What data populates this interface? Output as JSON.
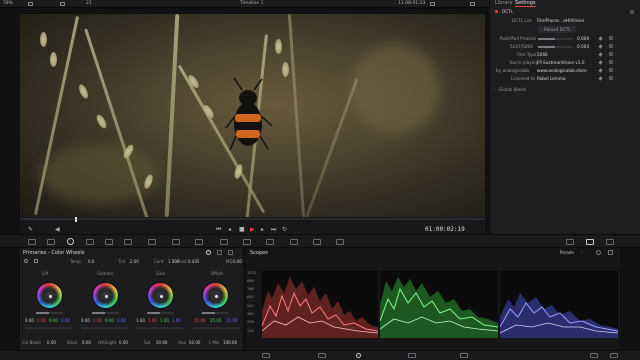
{
  "topbar": {
    "zoom": "78%",
    "timeline_title": "Timeline 1",
    "timecode": "11:08:01:23",
    "counter": "21"
  },
  "viewer": {
    "timecode": "01:00:02:19"
  },
  "right_panel": {
    "tabs": [
      "Library",
      "Settings"
    ],
    "section": "DCTL",
    "dctl_list_label": "DCTL List",
    "dctl_list_value": "FilmProces...aHtlVision",
    "reload_button": "Reload DCTL",
    "params": [
      {
        "label": "Push/Pull Process",
        "value": "0.009"
      },
      {
        "label": "5247/5293",
        "value": "0.504"
      },
      {
        "label": "Film Type",
        "value": "5066"
      },
      {
        "label": "You're playing",
        "value": "FP EastmanVision v1.0"
      },
      {
        "label": "by analogicalab",
        "value": "www.analogicalab.store"
      },
      {
        "label": "Licensed to",
        "value": "Robel Lemma"
      }
    ],
    "global_blend": "Global Blend"
  },
  "primaries": {
    "title": "Primaries - Color Wheels",
    "top_params": [
      {
        "label": "Temp",
        "value": "0.0"
      },
      {
        "label": "Tint",
        "value": "2.00"
      },
      {
        "label": "Cont",
        "value": "1.000"
      },
      {
        "label": "Pivot",
        "value": "0.435"
      },
      {
        "label": "MD",
        "value": "0.00"
      }
    ],
    "wheels": [
      {
        "name": "Lift",
        "values": [
          "0.00",
          "0.00",
          "0.00",
          "0.00"
        ]
      },
      {
        "name": "Gamma",
        "values": [
          "0.00",
          "0.00",
          "0.00",
          "0.00"
        ]
      },
      {
        "name": "Gain",
        "values": [
          "1.00",
          "1.00",
          "1.00",
          "1.00"
        ]
      },
      {
        "name": "Offset",
        "values": [
          "25.00",
          "25.00",
          "25.00",
          ""
        ]
      }
    ],
    "bottom_params": [
      {
        "label": "Col Boost",
        "value": "0.00"
      },
      {
        "label": "Shad",
        "value": "0.00"
      },
      {
        "label": "Hilt/Light",
        "value": "0.00"
      },
      {
        "label": "Sat",
        "value": "50.00"
      },
      {
        "label": "Hue",
        "value": "50.00"
      },
      {
        "label": "L Mix",
        "value": "100.00"
      }
    ],
    "footer": "DaVinci Resolve Studio 18.6"
  },
  "scopes": {
    "title": "Scopes",
    "mode": "Parade",
    "y_labels": [
      "1023",
      "896",
      "768",
      "640",
      "512",
      "384",
      "256",
      "128"
    ],
    "colors": {
      "red": "#ff4a4a",
      "green": "#3ee84a",
      "blue": "#5a62ff"
    }
  }
}
